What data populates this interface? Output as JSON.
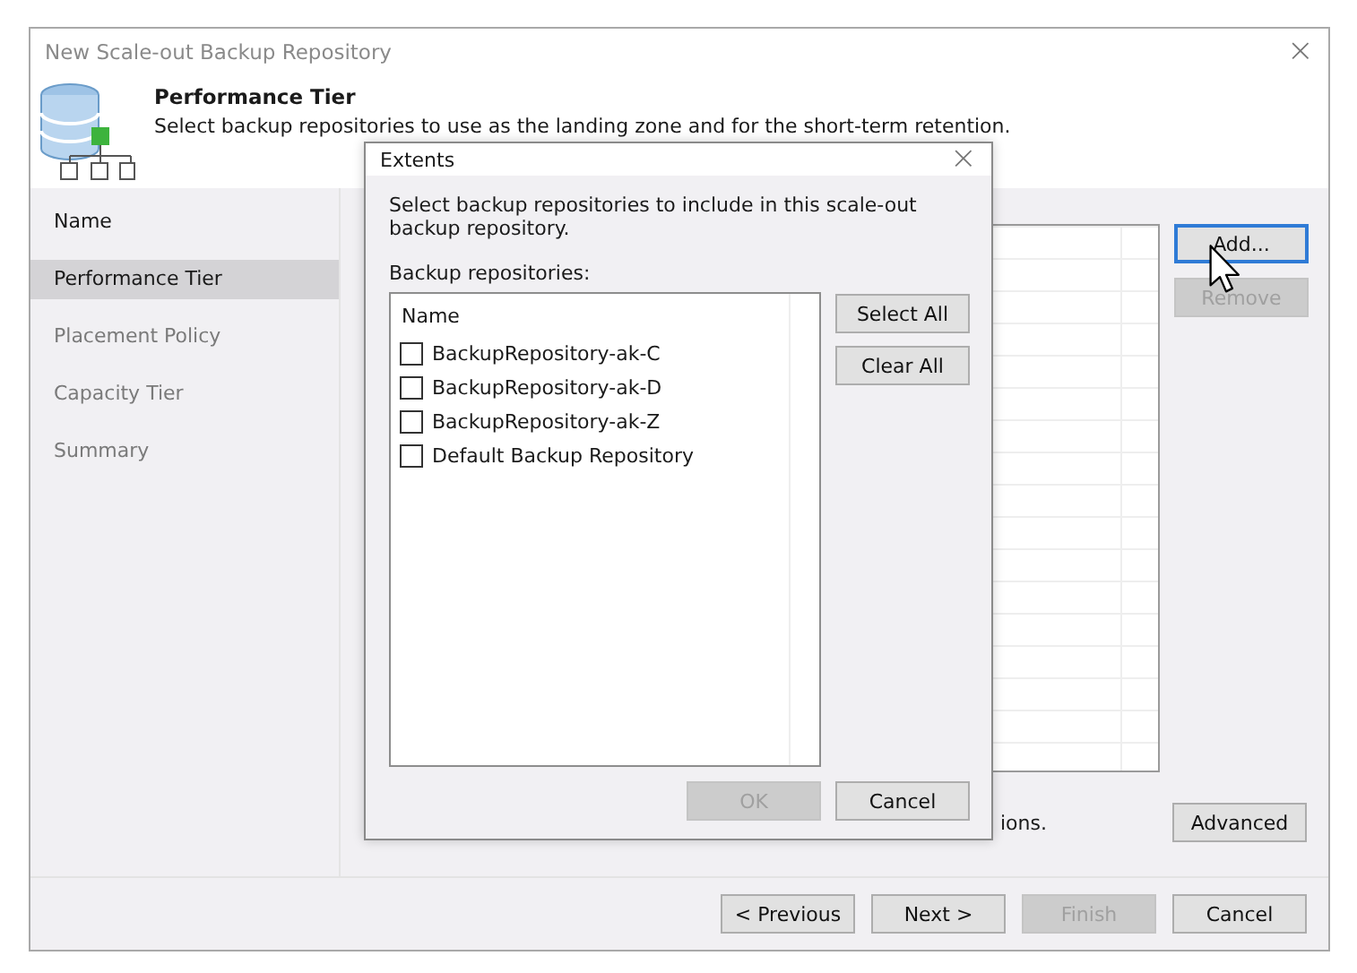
{
  "window": {
    "title": "New Scale-out Backup Repository",
    "close": "×"
  },
  "header": {
    "title": "Performance Tier",
    "subtitle": "Select backup repositories to use as the landing zone and for the short-term retention."
  },
  "sidebar": {
    "items": [
      {
        "label": "Name",
        "selected": false,
        "disabled": false
      },
      {
        "label": "Performance Tier",
        "selected": true,
        "disabled": false
      },
      {
        "label": "Placement Policy",
        "selected": false,
        "disabled": true
      },
      {
        "label": "Capacity Tier",
        "selected": false,
        "disabled": true
      },
      {
        "label": "Summary",
        "selected": false,
        "disabled": true
      }
    ]
  },
  "extents_panel": {
    "buttons": [
      {
        "label": "Add...",
        "disabled": false,
        "focused": true
      },
      {
        "label": "Remove",
        "disabled": true,
        "focused": false
      }
    ],
    "note": "ions.",
    "advanced_button": "Advanced"
  },
  "footer": {
    "buttons": [
      {
        "label": "< Previous",
        "disabled": false
      },
      {
        "label": "Next >",
        "disabled": false
      },
      {
        "label": "Finish",
        "disabled": true
      },
      {
        "label": "Cancel",
        "disabled": false
      }
    ]
  },
  "dialog": {
    "title": "Extents",
    "close": "×",
    "description": "Select backup repositories to include in this scale-out backup repository.",
    "list_label": "Backup repositories:",
    "column": "Name",
    "items": [
      {
        "label": "BackupRepository-ak-C",
        "checked": false
      },
      {
        "label": "BackupRepository-ak-D",
        "checked": false
      },
      {
        "label": "BackupRepository-ak-Z",
        "checked": false
      },
      {
        "label": "Default Backup Repository",
        "checked": false
      }
    ],
    "side_buttons": [
      "Select All",
      "Clear All"
    ],
    "buttons": [
      {
        "label": "OK",
        "disabled": true
      },
      {
        "label": "Cancel",
        "disabled": false
      }
    ]
  }
}
